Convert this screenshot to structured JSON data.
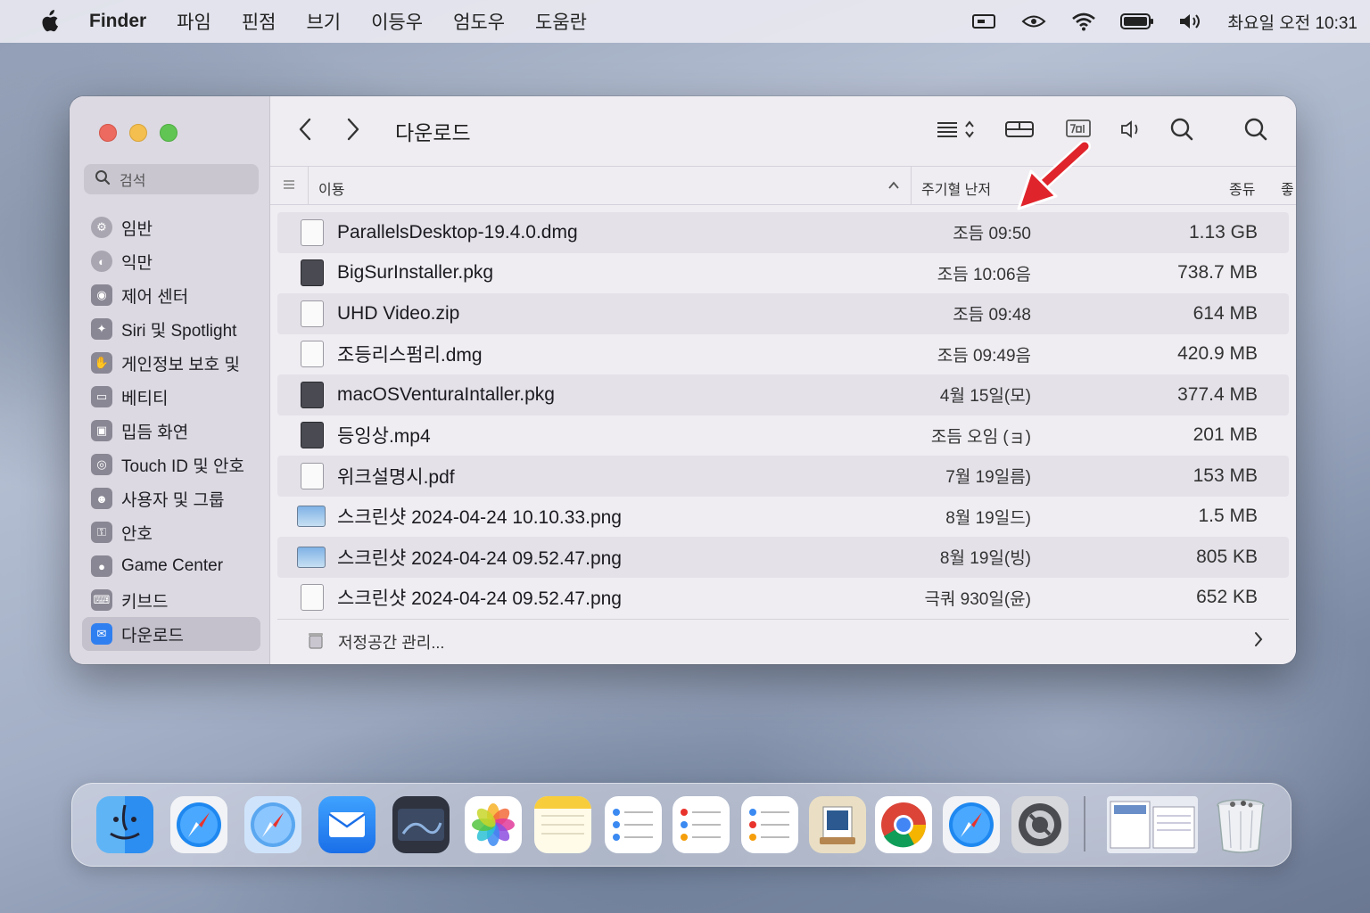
{
  "menubar": {
    "app_name": "Finder",
    "items": [
      "파임",
      "핀점",
      "브기",
      "이등우",
      "엄도우",
      "도움란"
    ],
    "clock": "촤요일 오전 10:31"
  },
  "sidebar": {
    "search_label": "검석",
    "items": [
      {
        "label": "임반",
        "icon": "general-icon"
      },
      {
        "label": "익만",
        "icon": "appearance-icon"
      },
      {
        "label": "제어 센터",
        "icon": "control-center-icon"
      },
      {
        "label": "Siri 및 Spotlight",
        "icon": "siri-icon"
      },
      {
        "label": "게인정보 보호 및",
        "icon": "privacy-hand-icon"
      },
      {
        "label": "베티티",
        "icon": "battery-icon"
      },
      {
        "label": "밉듬 화연",
        "icon": "lock-screen-icon"
      },
      {
        "label": "Touch ID 및 안호",
        "icon": "fingerprint-icon"
      },
      {
        "label": "사용자 및 그룹",
        "icon": "users-icon"
      },
      {
        "label": "안호",
        "icon": "password-icon"
      },
      {
        "label": "Game Center",
        "icon": "game-center-icon"
      },
      {
        "label": "키브드",
        "icon": "keyboard-icon"
      },
      {
        "label": "다운로드",
        "icon": "downloads-icon"
      }
    ]
  },
  "window": {
    "title": "다운로드",
    "columns": {
      "name": "이둉",
      "date": "주기혈 난저",
      "kind": "종듀",
      "extra": "좋"
    },
    "files": [
      {
        "name": "ParallelsDesktop-19.4.0.dmg",
        "date": "조듬 09:50",
        "size": "1.13 GB"
      },
      {
        "name": "BigSurInstaller.pkg",
        "date": "조듬 10:06음",
        "size": "738.7 MB"
      },
      {
        "name": "UHD Video.zip",
        "date": "조듬 09:48",
        "size": "614 MB"
      },
      {
        "name": "조등리스펌리.dmg",
        "date": "조듬 09:49음",
        "size": "420.9 MB"
      },
      {
        "name": "macOSVenturaIntaller.pkg",
        "date": "4월 15일(모)",
        "size": "377.4 MB"
      },
      {
        "name": "등잉상.mp4",
        "date": "조듬 오임 (ョ)",
        "size": "201 MB"
      },
      {
        "name": "위크설명시.pdf",
        "date": "7월 19일름)",
        "size": "153 MB"
      },
      {
        "name": "스크린샷 2024-04-24 10.10.33.png",
        "date": "8월 19일드)",
        "size": "1.5 MB"
      },
      {
        "name": "스크린샷 2024-04-24 09.52.47.png",
        "date": "8월 19일(빙)",
        "size": "805 KB"
      },
      {
        "name": "스크린샷 2024-04-24 09.52.47.png",
        "date": "극쿼 930일(윤)",
        "size": "652 KB"
      }
    ],
    "footer_label": "저정공간 관리..."
  },
  "colors": {
    "accent": "#2f7ff0",
    "annotation": "#e0242b"
  },
  "dock": {
    "apps": [
      "finder-icon",
      "safari-icon",
      "safari-alt-icon",
      "mail-icon",
      "photo-booth-icon",
      "photos-icon",
      "notes-icon",
      "reminders-icon",
      "reminders-alt-icon",
      "lists-icon",
      "preview-icon",
      "chrome-icon",
      "safari-third-icon",
      "system-settings-icon",
      "screenshots-icon",
      "trash-icon"
    ]
  }
}
